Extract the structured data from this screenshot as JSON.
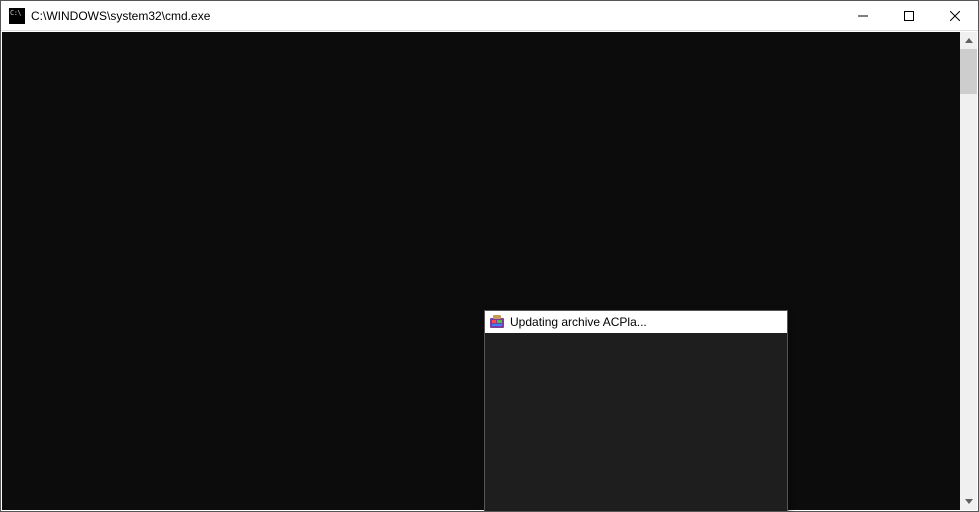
{
  "main_window": {
    "title": "C:\\WINDOWS\\system32\\cmd.exe",
    "icon": "cmd-icon"
  },
  "dialog": {
    "title": "Updating archive ACPla...",
    "icon": "winrar-icon"
  }
}
